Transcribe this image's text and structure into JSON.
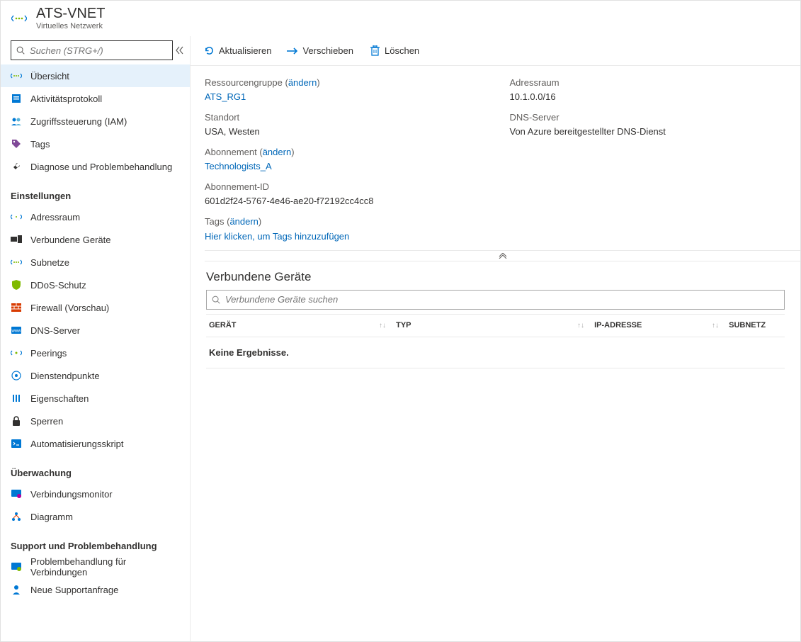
{
  "header": {
    "title": "ATS-VNET",
    "subtitle": "Virtuelles Netzwerk"
  },
  "sidebar": {
    "search_placeholder": "Suchen (STRG+/)",
    "nav": {
      "overview": "Übersicht",
      "activity": "Aktivitätsprotokoll",
      "iam": "Zugriffssteuerung (IAM)",
      "tags": "Tags",
      "diagnose": "Diagnose und Problembehandlung"
    },
    "section_settings": "Einstellungen",
    "settings": {
      "address": "Adressraum",
      "connected": "Verbundene Geräte",
      "subnets": "Subnetze",
      "ddos": "DDoS-Schutz",
      "firewall": "Firewall (Vorschau)",
      "dns": "DNS-Server",
      "peerings": "Peerings",
      "endpoints": "Dienstendpunkte",
      "properties": "Eigenschaften",
      "locks": "Sperren",
      "automation": "Automatisierungsskript"
    },
    "section_monitor": "Überwachung",
    "monitor": {
      "connmon": "Verbindungsmonitor",
      "diagram": "Diagramm"
    },
    "section_support": "Support und Problembehandlung",
    "support": {
      "trouble": "Problembehandlung für Verbindungen",
      "request": "Neue Supportanfrage"
    }
  },
  "toolbar": {
    "refresh": "Aktualisieren",
    "move": "Verschieben",
    "delete": "Löschen"
  },
  "essentials": {
    "rg_label": "Ressourcengruppe",
    "change": "ändern",
    "rg_val": "ATS_RG1",
    "loc_label": "Standort",
    "loc_val": "USA, Westen",
    "sub_label": "Abonnement",
    "sub_val": "Technologists_A",
    "subid_label": "Abonnement-ID",
    "subid_val": "601d2f24-5767-4e46-ae20-f72192cc4cc8",
    "addr_label": "Adressraum",
    "addr_val": "10.1.0.0/16",
    "dns_label": "DNS-Server",
    "dns_val": "Von Azure bereitgestellter DNS-Dienst",
    "tags_label": "Tags",
    "tags_action": "Hier klicken, um Tags hinzuzufügen"
  },
  "devices": {
    "title": "Verbundene Geräte",
    "search_placeholder": "Verbundene Geräte suchen",
    "col_device": "Gerät",
    "col_type": "Typ",
    "col_ip": "IP-Adresse",
    "col_subnet": "Subnetz",
    "no_results": "Keine Ergebnisse."
  }
}
